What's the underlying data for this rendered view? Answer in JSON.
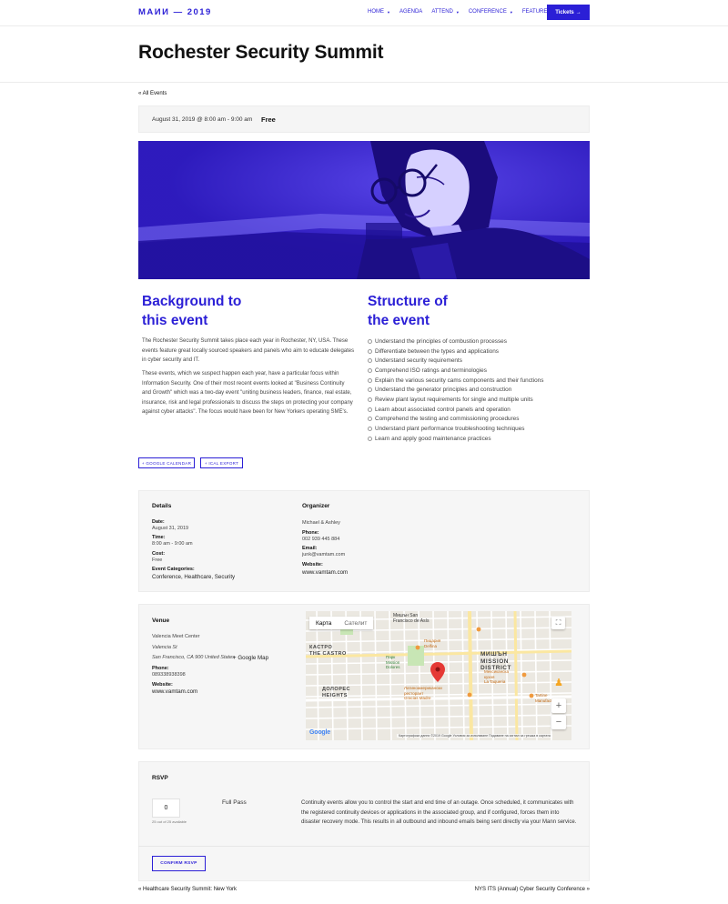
{
  "header": {
    "logo": "MAИИ — 2019",
    "nav": [
      {
        "label": "HOME",
        "has_caret": true
      },
      {
        "label": "AGENDA",
        "has_caret": false
      },
      {
        "label": "ATTEND",
        "has_caret": true
      },
      {
        "label": "CONFERENCE",
        "has_caret": true
      },
      {
        "label": "FEATURES",
        "has_caret": true
      }
    ],
    "tickets_label": "Tickets",
    "tickets_icon": "arrow-right-icon"
  },
  "event": {
    "title": "Rochester Security Summit",
    "back_link": "« All Events",
    "date_time": "August 31, 2019 @ 8:00 am - 9:00 am",
    "cost": "Free"
  },
  "background": {
    "heading_line1": "Background to",
    "heading_line2": "this event",
    "para1": "The Rochester Security Summit takes place each year in Rochester, NY, USA. These events feature great locally sourced speakers and panels who aim to educate delegates in cyber security and IT.",
    "para2": "These events, which we suspect happen each year, have a particular focus within Information Security. One of their most recent events looked at \"Business Continuity and Growth\" which was a two-day event \"uniting business leaders, finance, real estate, insurance, risk and legal professionals to discuss the steps on protecting your company against cyber attacks\". The focus would have been for New Yorkers operating SME's."
  },
  "structure": {
    "heading_line1": "Structure of",
    "heading_line2": "the event",
    "items": [
      "Understand the principles of combustion processes",
      "Differentiate between the types and applications",
      "Understand security requirements",
      "Comprehend ISO ratings and terminologies",
      "Explain the various security cams components and their functions",
      "Understand the generator principles and construction",
      "Review plant layout requirements for single and multiple units",
      "Learn about associated control panels and operation",
      "Comprehend the testing and commissioning procedures",
      "Understand plant performance troubleshooting techniques",
      "Learn and apply good maintenance practices"
    ]
  },
  "export": {
    "google_calendar": "+ GOOGLE CALENDAR",
    "ical_export": "+ ICAL EXPORT"
  },
  "details": {
    "title": "Details",
    "date_label": "Date:",
    "date_value": "August 31, 2019",
    "time_label": "Time:",
    "time_value": "8:00 am - 9:00 am",
    "cost_label": "Cost:",
    "cost_value": "Free",
    "categories_label": "Event Categories:",
    "categories_value": "Conference, Healthcare, Security"
  },
  "organizer": {
    "title": "Organizer",
    "name": "Michael & Ashley",
    "phone_label": "Phone:",
    "phone_value": "002 939 445 884",
    "email_label": "Email:",
    "email_value": "junk@vamtam.com",
    "website_label": "Website:",
    "website_value": "www.vamtam.com"
  },
  "venue": {
    "title": "Venue",
    "name": "Valencia Meet Center",
    "street": "Valencia St",
    "city_line": "San Francisco, CA 900 United States",
    "google_map": "+ Google Map",
    "phone_label": "Phone:",
    "phone_value": "089338938398",
    "website_label": "Website:",
    "website_value": "www.vamtam.com"
  },
  "map": {
    "tab_map": "Карта",
    "tab_satellite": "Сателит",
    "labels": {
      "mission": "Мишън San\nFrancisco de Asís",
      "castro": "КАСТРО\nTHE CASTRO",
      "mission_district": "МИШЪН\nMISSION\nDISTRICT",
      "dolores": "ДОЛОРЕС\nHEIGHTS",
      "park": "Парк\nMission\nDolores",
      "pizza": "Пицария\nDelfina",
      "restaurant": "Латиноамерикански\nресторант\nGracias Madre",
      "foreign": "Мексиканска\nкухня\nLa Taqueria",
      "tartine": "Tartine\nManufactory"
    },
    "google_logo": "Google",
    "attribution": "Картографски данни ©2019 Google   Условия за използване   Подаване на сигнал за грешка в картата"
  },
  "rsvp": {
    "title": "RSVP",
    "quantity": "0",
    "availability": "25 out of 25 available",
    "ticket_name": "Full Pass",
    "description": "Continuity events allow you to control the start and end time of an outage. Once scheduled, it communicates with the registered continuity devices or applications in the associated group, and if configured, forces them into disaster recovery mode. This results in all outbound and inbound emails being sent directly via your Mann service.",
    "confirm_label": "CONFIRM RSVP"
  },
  "footer": {
    "prev": "« Healthcare Security Summit: New York",
    "next": "NYS ITS (Annual) Cyber Security Conference »"
  },
  "colors": {
    "accent": "#2b1fd6",
    "panel_bg": "#f6f6f6"
  }
}
